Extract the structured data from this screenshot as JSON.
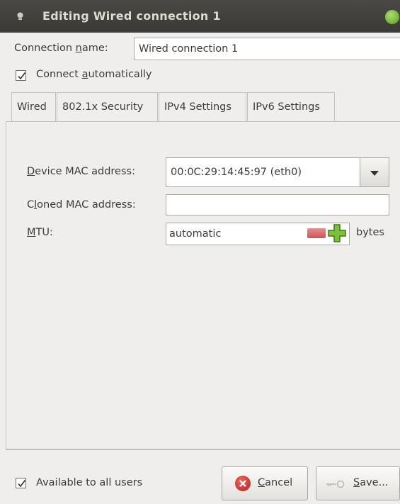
{
  "window": {
    "title": "Editing Wired connection 1"
  },
  "connection_name": {
    "label_pre": "Connection ",
    "label_mn": "n",
    "label_post": "ame:",
    "value": "Wired connection 1"
  },
  "connect_auto": {
    "label_pre": "Connect ",
    "label_mn": "a",
    "label_post": "utomatically",
    "checked": true
  },
  "tabs": [
    "Wired",
    "802.1x Security",
    "IPv4 Settings",
    "IPv6 Settings"
  ],
  "wired": {
    "device_mac_label_pre": "",
    "device_mac_label_mn": "D",
    "device_mac_label_post": "evice MAC address:",
    "device_mac_value": "00:0C:29:14:45:97 (eth0)",
    "cloned_mac_label_pre": "C",
    "cloned_mac_label_mn": "l",
    "cloned_mac_label_post": "oned MAC address:",
    "cloned_mac_value": "",
    "mtu_label_pre": "",
    "mtu_label_mn": "M",
    "mtu_label_post": "TU:",
    "mtu_value": "automatic",
    "mtu_unit": "bytes"
  },
  "footer": {
    "all_users_label": "Available to all users",
    "all_users_checked": true,
    "cancel_mn": "C",
    "cancel_rest": "ancel",
    "save_mn": "S",
    "save_rest": "ave..."
  }
}
